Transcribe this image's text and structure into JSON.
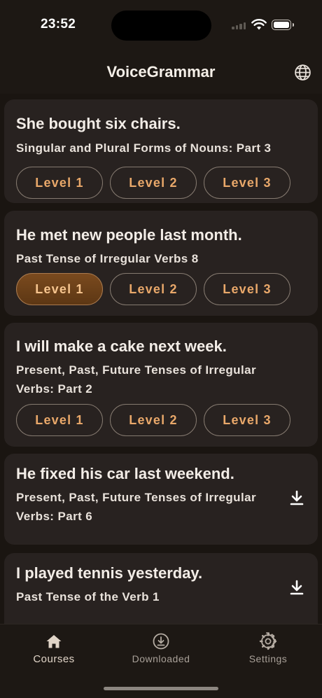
{
  "status_bar": {
    "time": "23:52"
  },
  "header": {
    "title": "VoiceGrammar",
    "globe_icon": "globe-icon"
  },
  "levels": [
    "Level 1",
    "Level 2",
    "Level 3"
  ],
  "cards": [
    {
      "title": "She bought six chairs.",
      "subtitle": "Singular and Plural Forms of Nouns: Part 3",
      "selected_level": null
    },
    {
      "title": "He met new people last month.",
      "subtitle": "Past Tense of Irregular Verbs 8",
      "selected_level": "Level 1"
    },
    {
      "title": "I will make a cake next week.",
      "subtitle": "Present, Past, Future Tenses of Irregular Verbs: Part 2",
      "selected_level": null
    },
    {
      "title": "He fixed his car last weekend.",
      "subtitle": "Present, Past, Future Tenses of Irregular Verbs: Part 6",
      "action_icon": "download-icon"
    },
    {
      "title": "I played tennis yesterday.",
      "subtitle": "Past Tense of the Verb 1",
      "action_icon": "download-icon"
    }
  ],
  "tab_bar": {
    "tabs": [
      {
        "label": "Courses",
        "icon": "house-icon",
        "active": true
      },
      {
        "label": "Downloaded",
        "icon": "download-circle-icon",
        "active": false
      },
      {
        "label": "Settings",
        "icon": "gear-icon",
        "active": false
      }
    ]
  },
  "colors": {
    "accent": "#e9a86a",
    "background": "#1d1814",
    "card": "#282220"
  }
}
